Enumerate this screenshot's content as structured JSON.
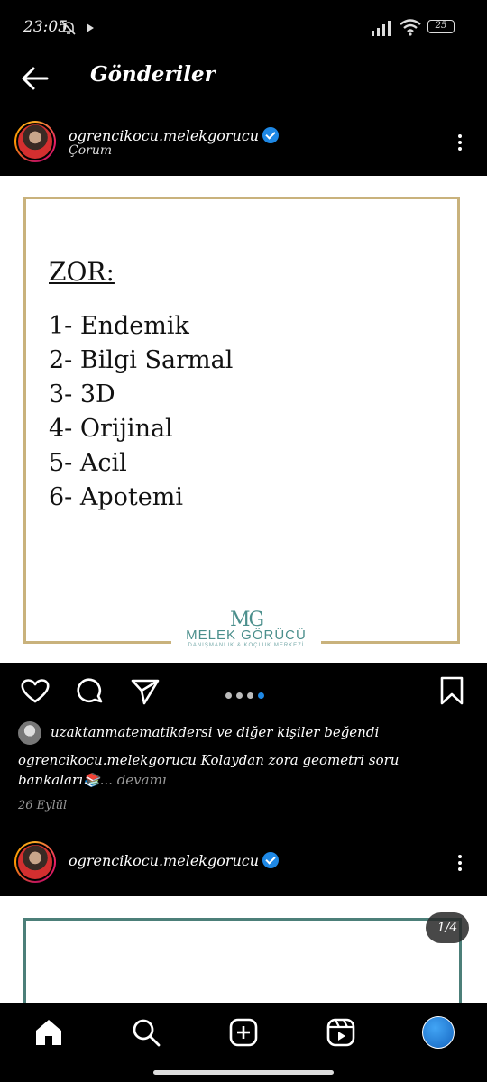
{
  "status_bar": {
    "time": "23:05",
    "battery": "25",
    "icons": [
      "bell-off-icon",
      "play-icon",
      "signal-icon",
      "wifi-icon",
      "battery-icon"
    ]
  },
  "header": {
    "title": "Gönderiler",
    "back_icon": "arrow-left-icon"
  },
  "post1": {
    "username": "ogrencikocu.melekgorucu",
    "location": "Çorum",
    "image": {
      "heading": "ZOR:",
      "items": [
        "1- Endemik",
        "2- Bilgi Sarmal",
        "3- 3D",
        "4- Orijinal",
        "5- Acil",
        "6- Apotemi"
      ],
      "logo_monogram": "MG",
      "logo_text": "MELEK GÖRÜCÜ",
      "logo_subtext": "DANIŞMANLIK & KOÇLUK MERKEZİ"
    },
    "likes_text": "uzaktanmatematikdersi ve diğer kişiler beğendi",
    "caption_user": "ogrencikocu.melekgorucu",
    "caption_text": " Kolaydan zora geometri soru bankaları📚",
    "caption_more": "... devamı",
    "date": "26 Eylül"
  },
  "post2": {
    "username": "ogrencikocu.melekgorucu",
    "page_indicator": "1/4"
  },
  "colors": {
    "accent": "#1e88e5",
    "frame_gold": "#c9b27c",
    "frame_teal": "#4c7f79"
  },
  "bottom_nav": [
    "home-icon",
    "search-icon",
    "add-post-icon",
    "reels-icon",
    "profile-avatar"
  ]
}
